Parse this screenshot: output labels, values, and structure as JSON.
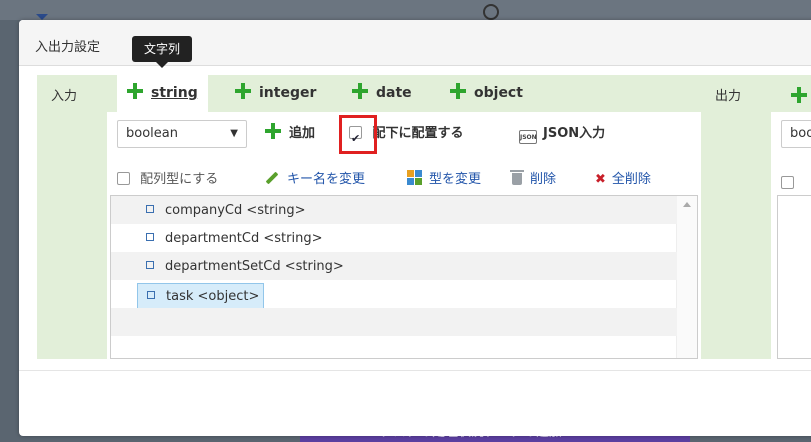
{
  "dialog": {
    "title": "入出力設定",
    "tooltip": "文字列"
  },
  "input": {
    "label": "入力",
    "tabs": [
      "string",
      "integer",
      "date",
      "object"
    ],
    "active_tab": "string",
    "type_select": "boolean",
    "add_label": "追加",
    "place_under_label": "配下に配置する",
    "place_under_checked": true,
    "json_label": "JSON入力",
    "json_icon_text": "JSON",
    "array_label": "配列型にする",
    "rename_label": "キー名を変更",
    "change_type_label": "型を変更",
    "delete_label": "削除",
    "delete_all_label": "全削除",
    "tree_items": [
      {
        "text": "companyCd <string>"
      },
      {
        "text": "departmentCd <string>"
      },
      {
        "text": "departmentSetCd <string>"
      },
      {
        "text": "task <object>",
        "selected": true
      }
    ]
  },
  "output": {
    "label": "出力",
    "type_select": "boo"
  },
  "background": {
    "bottom_text": "タスクの処理状況データの追加"
  },
  "colors": {
    "panel_green": "#e2efd9",
    "plus_green": "#2ea52e",
    "highlight_red": "#e02020",
    "link_blue": "#2255aa",
    "selection_blue": "#d6ecfa"
  }
}
